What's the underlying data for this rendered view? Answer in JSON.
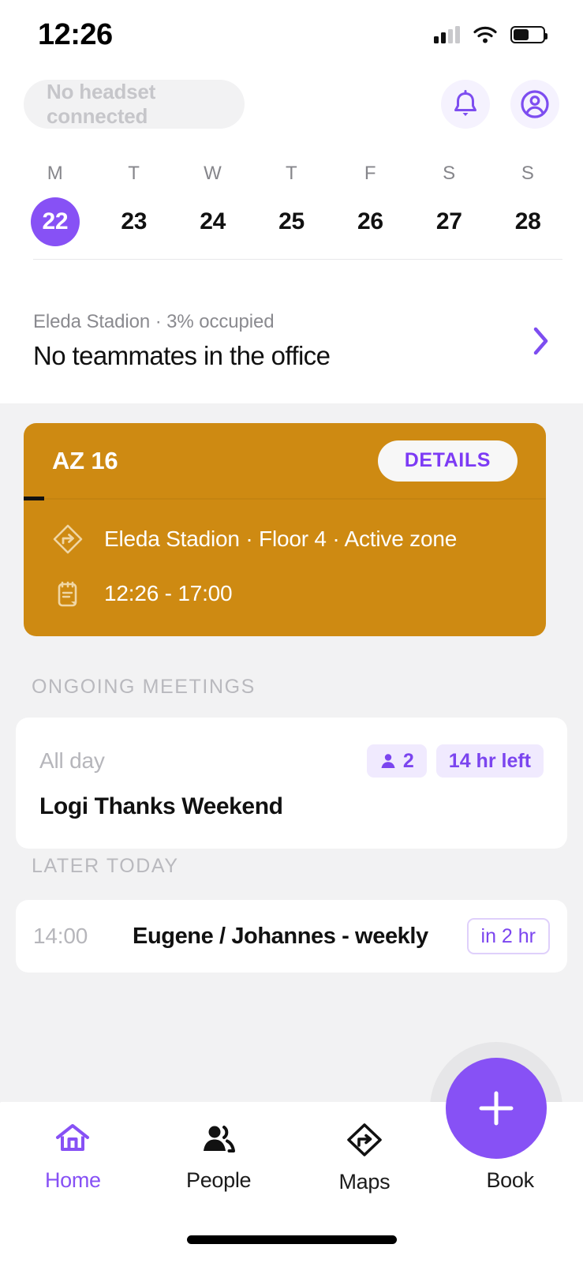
{
  "status_bar": {
    "time": "12:26",
    "signal_icon": "cellular-signal-icon",
    "wifi_icon": "wifi-icon",
    "battery_icon": "battery-icon"
  },
  "header": {
    "headset_status": "No headset connected",
    "notifications_icon": "bell-icon",
    "account_icon": "account-circle-icon"
  },
  "week_strip": {
    "days": [
      {
        "dow": "M",
        "date": "22",
        "selected": true
      },
      {
        "dow": "T",
        "date": "23",
        "selected": false
      },
      {
        "dow": "W",
        "date": "24",
        "selected": false
      },
      {
        "dow": "T",
        "date": "25",
        "selected": false
      },
      {
        "dow": "F",
        "date": "26",
        "selected": false
      },
      {
        "dow": "S",
        "date": "27",
        "selected": false
      },
      {
        "dow": "S",
        "date": "28",
        "selected": false
      }
    ]
  },
  "occupancy": {
    "subtitle": "Eleda Stadion · 3% occupied",
    "title": "No teammates in the office",
    "chevron_icon": "chevron-right-icon"
  },
  "booking_card": {
    "title": "AZ 16",
    "details_label": "DETAILS",
    "location": "Eleda Stadion · Floor 4 · Active zone",
    "time_range": "12:26 - 17:00",
    "location_icon": "wayfinding-diamond-icon",
    "booking_icon": "desk-booking-icon",
    "color": "#ce8a12"
  },
  "sections": {
    "ongoing_label": "ONGOING MEETINGS",
    "later_label": "LATER TODAY"
  },
  "ongoing_meeting": {
    "time": "All day",
    "title": "Logi Thanks Weekend",
    "attendees_icon": "person-icon",
    "attendees_count": "2",
    "time_left": "14 hr left"
  },
  "later_meeting": {
    "time": "14:00",
    "title": "Eugene / Johannes - weekly",
    "starts_in": "in 2 hr"
  },
  "bottom_nav": {
    "items": [
      {
        "label": "Home",
        "icon": "home-icon",
        "active": true
      },
      {
        "label": "People",
        "icon": "people-icon",
        "active": false
      },
      {
        "label": "Maps",
        "icon": "maps-diamond-icon",
        "active": false
      },
      {
        "label": "Book",
        "icon": "plus-icon",
        "active": false
      }
    ],
    "fab_icon": "plus-icon"
  },
  "colors": {
    "accent": "#8751f5",
    "accent_text": "#7b45ef",
    "card_orange": "#ce8a12",
    "page_bg": "#f2f2f3",
    "muted_text": "#b6b6bb"
  }
}
